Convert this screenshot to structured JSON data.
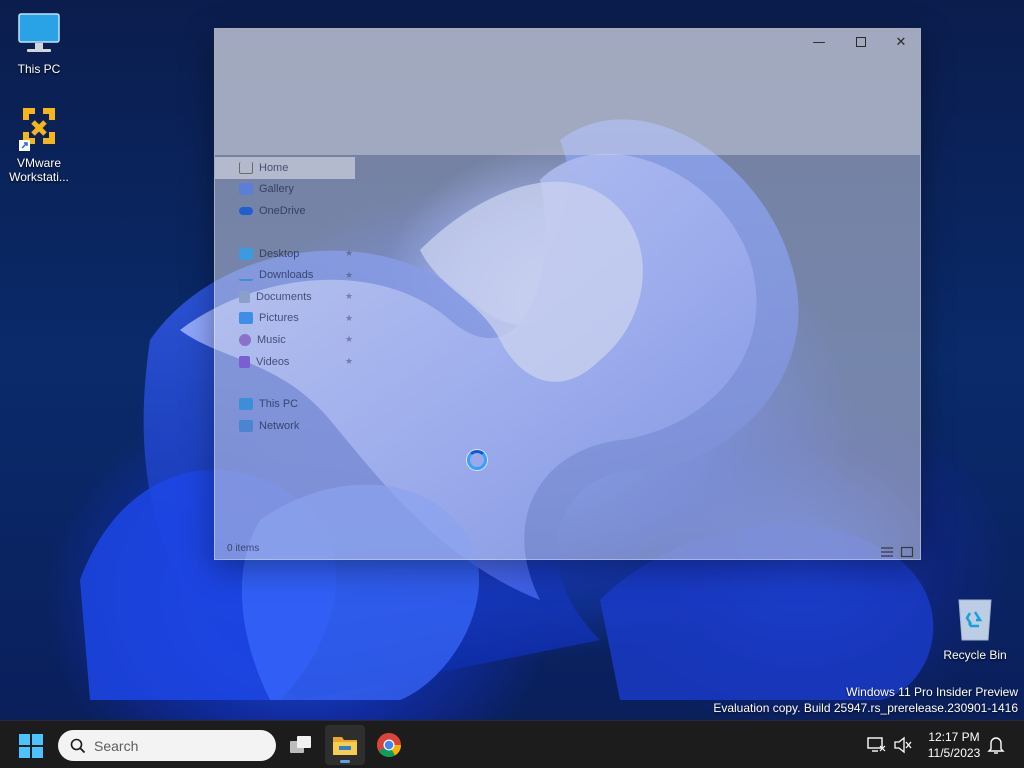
{
  "desktop": {
    "icons": [
      {
        "label": "This PC"
      },
      {
        "label": "VMware Workstati..."
      },
      {
        "label": "Recycle Bin"
      }
    ]
  },
  "explorer": {
    "nav": {
      "items": [
        {
          "label": "Home",
          "selected": true
        },
        {
          "label": "Gallery"
        },
        {
          "label": "OneDrive"
        }
      ],
      "quick_access": [
        {
          "label": "Desktop",
          "pinned": true
        },
        {
          "label": "Downloads",
          "pinned": true
        },
        {
          "label": "Documents",
          "pinned": true
        },
        {
          "label": "Pictures",
          "pinned": true
        },
        {
          "label": "Music",
          "pinned": true
        },
        {
          "label": "Videos",
          "pinned": true
        }
      ],
      "locations": [
        {
          "label": "This PC"
        },
        {
          "label": "Network"
        }
      ]
    },
    "status": "0 items"
  },
  "watermark": {
    "line1": "Windows 11 Pro Insider Preview",
    "line2": "Evaluation copy. Build 25947.rs_prerelease.230901-1416"
  },
  "taskbar": {
    "search_label": "Search",
    "apps": [
      {
        "icon": "task-view-icon"
      },
      {
        "icon": "file-explorer-icon",
        "active": true
      },
      {
        "icon": "chrome-icon"
      }
    ],
    "clock": {
      "time": "12:17 PM",
      "date": "11/5/2023"
    }
  },
  "colors": {
    "accent": "#0078d4",
    "folder": "#f4c542",
    "taskbar": "#1c1c1c"
  }
}
